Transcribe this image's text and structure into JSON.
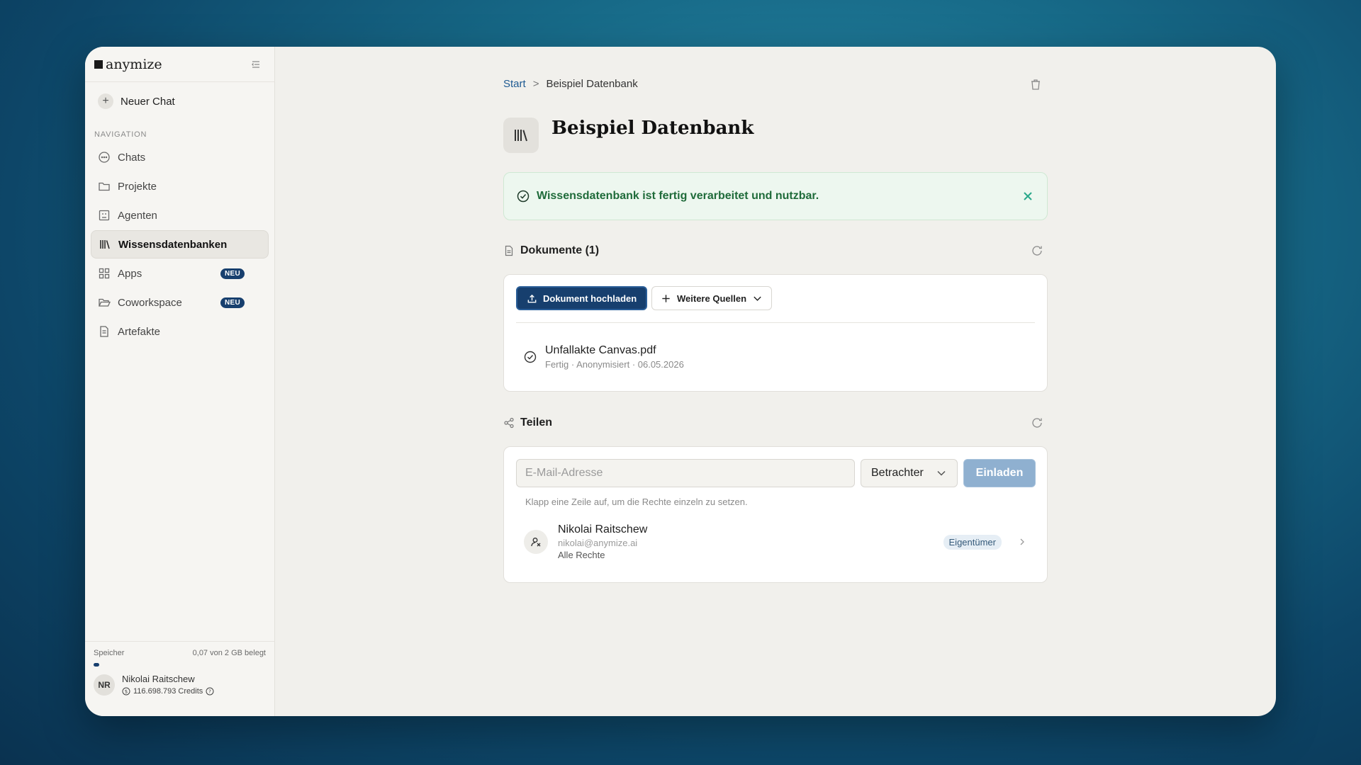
{
  "brand": {
    "name": "anymize"
  },
  "sidebar": {
    "new_chat": "Neuer Chat",
    "nav_label": "NAVIGATION",
    "items": [
      {
        "label": "Chats",
        "icon": "chat-bubble-icon"
      },
      {
        "label": "Projekte",
        "icon": "folder-icon"
      },
      {
        "label": "Agenten",
        "icon": "agent-icon"
      },
      {
        "label": "Wissensdatenbanken",
        "icon": "library-icon",
        "active": true
      },
      {
        "label": "Apps",
        "icon": "grid-icon",
        "badge": "NEU"
      },
      {
        "label": "Coworkspace",
        "icon": "folder-open-icon",
        "badge": "NEU"
      },
      {
        "label": "Artefakte",
        "icon": "document-icon"
      }
    ],
    "storage": {
      "label": "Speicher",
      "usage": "0,07 von 2 GB belegt",
      "fraction": 0.035
    },
    "user": {
      "initials": "NR",
      "name": "Nikolai Raitschew",
      "credits": "116.698.793 Credits"
    }
  },
  "main": {
    "breadcrumb": {
      "root": "Start",
      "separator": ">",
      "current": "Beispiel Datenbank"
    },
    "title": "Beispiel Datenbank",
    "success_message": "Wissensdatenbank ist fertig verarbeitet und nutzbar.",
    "documents": {
      "heading": "Dokumente (1)",
      "upload_label": "Dokument hochladen",
      "more_sources_label": "Weitere Quellen",
      "items": [
        {
          "name": "Unfallakte Canvas.pdf",
          "meta": "Fertig · Anonymisiert · 06.05.2026"
        }
      ]
    },
    "share": {
      "heading": "Teilen",
      "email_placeholder": "E-Mail-Adresse",
      "role_value": "Betrachter",
      "invite_label": "Einladen",
      "hint": "Klapp eine Zeile auf, um die Rechte einzeln zu setzen.",
      "members": [
        {
          "name": "Nikolai Raitschew",
          "email": "nikolai@anymize.ai",
          "rights": "Alle Rechte",
          "role": "Eigentümer"
        }
      ]
    }
  },
  "colors": {
    "primary": "#173f6e",
    "success_bg": "#edf7ef",
    "success_text": "#1f6b3a",
    "link": "#1e5a92"
  }
}
